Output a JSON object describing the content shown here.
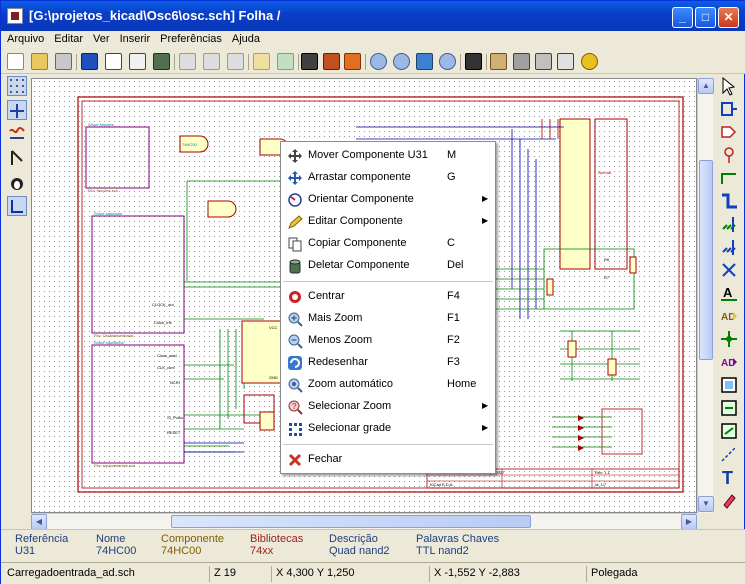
{
  "window": {
    "title": "[G:\\projetos_kicad\\Osc6\\osc.sch]  Folha /"
  },
  "menu": [
    "Arquivo",
    "Editar",
    "Ver",
    "Inserir",
    "Preferências",
    "Ajuda"
  ],
  "context_menu": {
    "items": [
      {
        "label": "Mover Componente U31",
        "shortcut": "M",
        "icon": "move-icon"
      },
      {
        "label": "Arrastar componente",
        "shortcut": "G",
        "icon": "drag-icon"
      },
      {
        "label": "Orientar Componente",
        "shortcut": "",
        "icon": "orient-icon",
        "submenu": true
      },
      {
        "label": "Editar Componente",
        "shortcut": "",
        "icon": "edit-icon",
        "submenu": true
      },
      {
        "label": "Copiar Componente",
        "shortcut": "C",
        "icon": "copy-icon"
      },
      {
        "label": "Deletar Componente",
        "shortcut": "Del",
        "icon": "delete-icon"
      },
      {
        "label": "Centrar",
        "shortcut": "F4",
        "icon": "center-icon"
      },
      {
        "label": "Mais Zoom",
        "shortcut": "F1",
        "icon": "zoom-in-icon"
      },
      {
        "label": "Menos Zoom",
        "shortcut": "F2",
        "icon": "zoom-out-icon"
      },
      {
        "label": "Redesenhar",
        "shortcut": "F3",
        "icon": "redraw-icon"
      },
      {
        "label": "Zoom automático",
        "shortcut": "Home",
        "icon": "zoom-auto-icon"
      },
      {
        "label": "Selecionar Zoom",
        "shortcut": "",
        "icon": "select-zoom-icon",
        "submenu": true
      },
      {
        "label": "Selecionar grade",
        "shortcut": "",
        "icon": "grid-icon",
        "submenu": true
      },
      {
        "label": "Fechar",
        "shortcut": "",
        "icon": "close-x-icon"
      }
    ]
  },
  "info_panel": {
    "referencia": {
      "label": "Referência",
      "value": "U31"
    },
    "nome": {
      "label": "Nome",
      "value": "74HC00"
    },
    "componente": {
      "label": "Componente",
      "value": "74HC00"
    },
    "bibliotecas": {
      "label": "Bibliotecas",
      "value": "74xx"
    },
    "descricao": {
      "label": "Descrição",
      "value": "Quad nand2"
    },
    "palavras": {
      "label": "Palavras Chaves",
      "value": "TTL nand2"
    }
  },
  "status": {
    "message": "Carregadoentrada_ad.sch",
    "zoom": "Z 19",
    "abs_coords": "X 4,300  Y 1,250",
    "rel_coords": "X -1,552  Y -2,883",
    "units": "Polegada"
  },
  "schematic_labels": {
    "sheet1": "Shunt funções",
    "sheet1_file": "Filo: funções.sch",
    "sheet2": "Shunt saturador",
    "sheet3_file": "Filo: Osciladorentrada",
    "sheet3": "Shunt equilibrios",
    "sheet4_file": "Filo: equipamentos.sch",
    "u_label": "74HC00",
    "normal": "Normal",
    "net1": "CLOCK_out",
    "net2": "Clock_Init",
    "net3": "Clock_said",
    "net4": "CLK_cont",
    "net5": "NCRI",
    "net6": "SI_Pulso",
    "net7": "RESET",
    "vcc": "VCC",
    "gnd": "GND",
    "xtal": "XTAL",
    "title_block1": "Size: A4",
    "title_block2": "Date: 09 jul 2007",
    "title_block3": "KiCad E.D.A.",
    "title_block4": "Rev: 1.1",
    "title_block5": "Id: 1/7",
    "r_label": "R6",
    "rs_label": "R7"
  },
  "colors": {
    "accent": "#0a3fc8",
    "wire": "#008800",
    "part": "#aa0000",
    "bus": "#0000aa",
    "sheet": "#800080"
  }
}
